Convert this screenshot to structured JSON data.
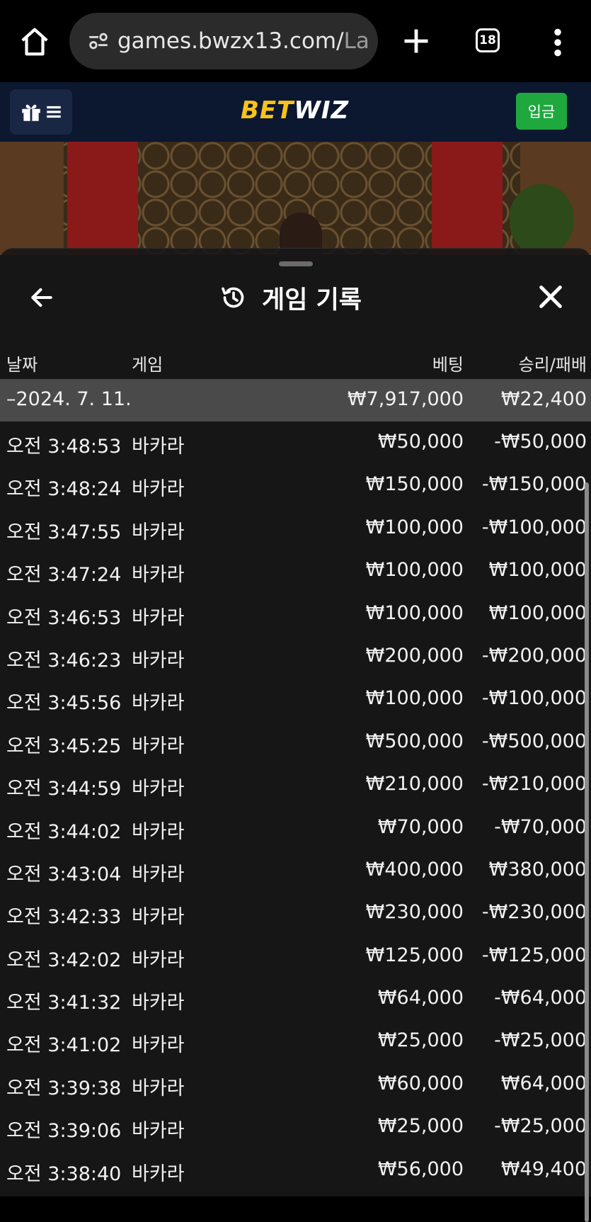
{
  "browser": {
    "url_main": "games.bwzx13.com/",
    "url_tail": "La",
    "tab_count": "18"
  },
  "site": {
    "logo_bet": "BET",
    "logo_wiz": "WIZ",
    "deposit_label": "입금"
  },
  "modal": {
    "title": "게임 기록",
    "columns": {
      "date": "날짜",
      "game": "게임",
      "bet": "베팅",
      "win_loss": "승리/패배"
    },
    "summary": {
      "date": "–2024. 7. 11.",
      "bet": "₩7,917,000",
      "win_loss": "₩22,400"
    },
    "rows": [
      {
        "time": "오전 3:48:53",
        "game": "바카라",
        "bet": "₩50,000",
        "result": "-₩50,000"
      },
      {
        "time": "오전 3:48:24",
        "game": "바카라",
        "bet": "₩150,000",
        "result": "-₩150,000"
      },
      {
        "time": "오전 3:47:55",
        "game": "바카라",
        "bet": "₩100,000",
        "result": "-₩100,000"
      },
      {
        "time": "오전 3:47:24",
        "game": "바카라",
        "bet": "₩100,000",
        "result": "₩100,000"
      },
      {
        "time": "오전 3:46:53",
        "game": "바카라",
        "bet": "₩100,000",
        "result": "₩100,000"
      },
      {
        "time": "오전 3:46:23",
        "game": "바카라",
        "bet": "₩200,000",
        "result": "-₩200,000"
      },
      {
        "time": "오전 3:45:56",
        "game": "바카라",
        "bet": "₩100,000",
        "result": "-₩100,000"
      },
      {
        "time": "오전 3:45:25",
        "game": "바카라",
        "bet": "₩500,000",
        "result": "-₩500,000"
      },
      {
        "time": "오전 3:44:59",
        "game": "바카라",
        "bet": "₩210,000",
        "result": "-₩210,000"
      },
      {
        "time": "오전 3:44:02",
        "game": "바카라",
        "bet": "₩70,000",
        "result": "-₩70,000"
      },
      {
        "time": "오전 3:43:04",
        "game": "바카라",
        "bet": "₩400,000",
        "result": "₩380,000"
      },
      {
        "time": "오전 3:42:33",
        "game": "바카라",
        "bet": "₩230,000",
        "result": "-₩230,000"
      },
      {
        "time": "오전 3:42:02",
        "game": "바카라",
        "bet": "₩125,000",
        "result": "-₩125,000"
      },
      {
        "time": "오전 3:41:32",
        "game": "바카라",
        "bet": "₩64,000",
        "result": "-₩64,000"
      },
      {
        "time": "오전 3:41:02",
        "game": "바카라",
        "bet": "₩25,000",
        "result": "-₩25,000"
      },
      {
        "time": "오전 3:39:38",
        "game": "바카라",
        "bet": "₩60,000",
        "result": "₩64,000"
      },
      {
        "time": "오전 3:39:06",
        "game": "바카라",
        "bet": "₩25,000",
        "result": "-₩25,000"
      },
      {
        "time": "오전 3:38:40",
        "game": "바카라",
        "bet": "₩56,000",
        "result": "₩49,400"
      }
    ]
  },
  "icons": {
    "home": "home-icon",
    "site_info": "tune-icon",
    "new_tab": "plus-icon",
    "menu": "kebab-menu-icon",
    "gift": "gift-icon",
    "hamburger": "hamburger-icon",
    "back": "arrow-left-icon",
    "history": "history-icon",
    "close": "close-icon"
  }
}
